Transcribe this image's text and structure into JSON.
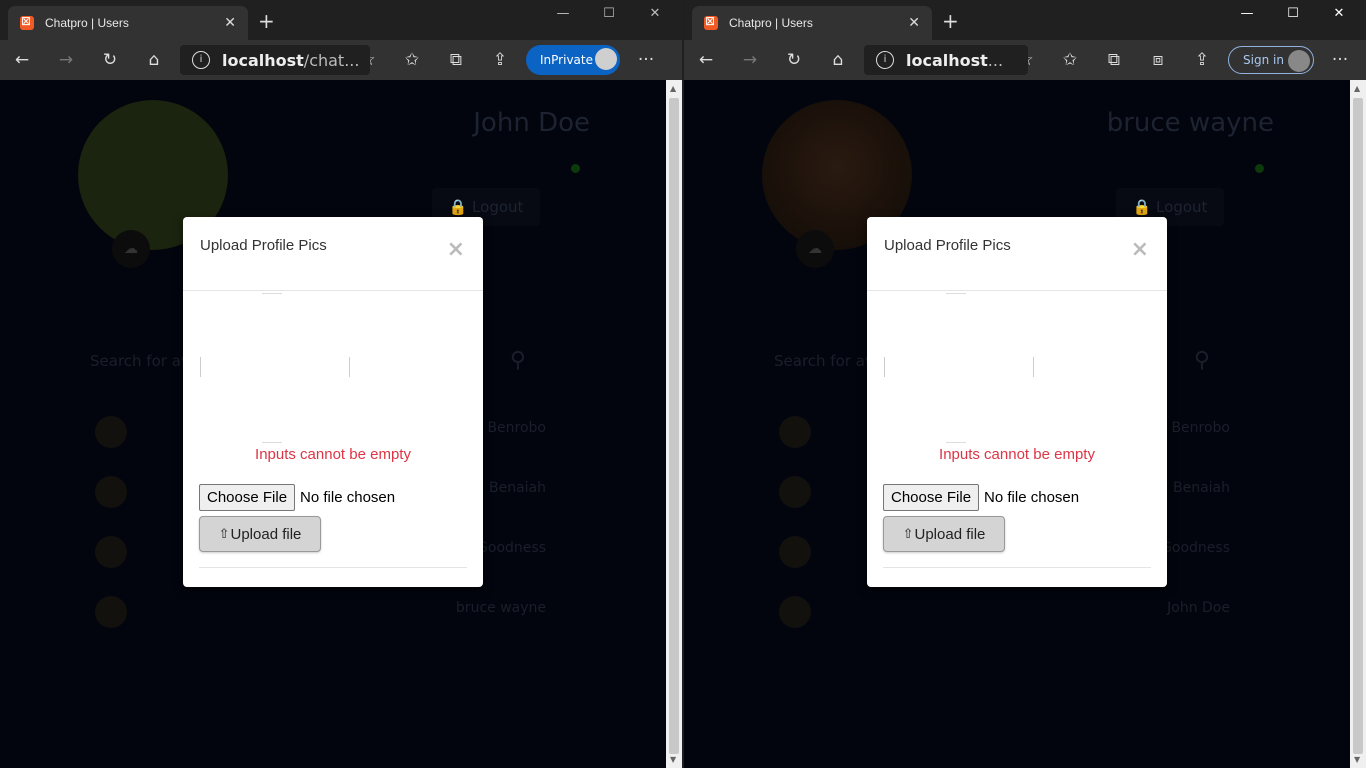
{
  "left": {
    "tab_title": "Chatpro | Users",
    "address_bold": "localhost",
    "address_rest": "/chat...",
    "inprivate_label": "InPrivate",
    "profile_name": "John Doe",
    "logout_label": "Logout",
    "search_placeholder": "Search for ava",
    "users": [
      "Benrobo",
      "Benaiah",
      "Goodness",
      "bruce wayne"
    ]
  },
  "right": {
    "tab_title": "Chatpro | Users",
    "address_bold": "localhost",
    "address_rest": "...",
    "signin_label": "Sign in",
    "profile_name": "bruce wayne",
    "logout_label": "Logout",
    "search_placeholder": "Search for ava",
    "users": [
      "Benrobo",
      "Benaiah",
      "Goodness",
      "John Doe"
    ]
  },
  "modal": {
    "title": "Upload Profile Pics",
    "close": "×",
    "error": "Inputs cannot be empty",
    "choose_file": "Choose File",
    "no_file": "No file chosen",
    "upload_label": "Upload file"
  },
  "icons": {
    "back": "back-arrow-icon",
    "forward": "forward-arrow-icon",
    "refresh": "refresh-icon",
    "home": "home-icon",
    "favorites": "favorites-icon",
    "collections": "collections-icon",
    "share": "share-icon",
    "more": "more-icon",
    "upload": "cloud-upload-icon"
  },
  "colors": {
    "error": "#dc3545",
    "inprivate": "#0b63c4",
    "tab_favicon": "#f15a24"
  }
}
